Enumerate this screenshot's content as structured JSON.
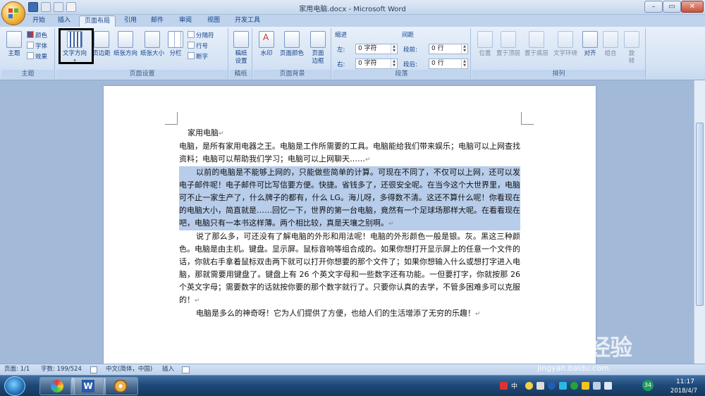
{
  "window": {
    "title": "家用电脑.docx - Microsoft Word",
    "minimize": "–",
    "maximize": "▭",
    "close": "✕"
  },
  "tabs": [
    "开始",
    "插入",
    "页面布局",
    "引用",
    "邮件",
    "审阅",
    "视图",
    "开发工具"
  ],
  "active_tab": "页面布局",
  "ribbon": {
    "theme": {
      "themes": "主题",
      "colors": "颜色",
      "fonts": "字体",
      "effects": "效果",
      "group": "主题"
    },
    "page_setup": {
      "text_direction": "文字方向",
      "margins": "页边距",
      "orientation": "纸张方向",
      "size": "纸张大小",
      "columns": "分栏",
      "breaks": "分隔符",
      "line_numbers": "行号",
      "hyphenation": "断字",
      "group": "页面设置"
    },
    "paper": {
      "draft": "稿纸设置",
      "group": "稿纸"
    },
    "background": {
      "watermark": "水印",
      "page_color": "页面颜色",
      "page_borders": "页面边框",
      "group": "页面背景"
    },
    "paragraph": {
      "indent_title": "缩进",
      "left_label": "左:",
      "left_value": "0 字符",
      "right_label": "右:",
      "right_value": "0 字符",
      "spacing_title": "间距",
      "before_label": "段前:",
      "before_value": "0 行",
      "after_label": "段后:",
      "after_value": "0 行",
      "group": "段落"
    },
    "arrange": {
      "position": "位置",
      "front": "置于顶层",
      "back": "置于底层",
      "wrap": "文字环绕",
      "align": "对齐",
      "group_btn": "组合",
      "rotate": "旋转",
      "group": "排列"
    }
  },
  "document": {
    "title": "家用电脑",
    "paragraphs": [
      {
        "text": "电脑，是所有家用电器之王。电脑是工作所需要的工具。电脑能给我们带来娱乐；电脑可以上网查找资料；电脑可以帮助我们学习；电脑可以上网聊天……",
        "selected": false,
        "indent": false
      },
      {
        "text": "以前的电脑是不能够上网的，只能做些简单的计算。可现在不同了，不仅可以上网，还可以发电子邮件呢！电子邮件可比写信要方便。快捷。省钱多了，还很安全呢。在当今这个大世界里，电脑可不止一家生产了，什么牌子的都有，什么 LG。海儿呀，多得数不清。这还不算什么呢！你看现在的电脑大小，简直就是……回忆一下，世界的第一台电脑，竟然有一个足球场那样大呢。在看看现在吧，电脑只有一本书这样薄。两个相比较，真是天壤之别啊。",
        "selected": true,
        "indent": true
      },
      {
        "text": "说了那么多，可还没有了解电脑的外形和用法呢！电脑的外形颜色一般是银。灰。黑这三种颜色。电脑是由主机。键盘。显示屏。鼠标音响等组合成的。如果你想打开显示屏上的任意一个文件的话，你就右手拿着鼠标双击两下就可以打开你想要的那个文件了；如果你想输入什么或想打字进入电脑，那就需要用键盘了。键盘上有 26 个英文字母和一些数字还有功能。一但要打字，你就按那 26 个英文字母；需要数字的话就按你要的那个数字就行了。只要你认真的去学，不管多困难多可以克服的！",
        "selected": false,
        "indent": true
      },
      {
        "text": "电脑是多么的神奇呀！它为人们提供了方便，也给人们的生活增添了无穷的乐趣！",
        "selected": false,
        "indent": true
      }
    ]
  },
  "status": {
    "page": "页面: 1/1",
    "words": "字数: 199/524",
    "language": "中文(简体，中国)",
    "mode": "插入"
  },
  "tray": {
    "ime": "中",
    "badge": "34",
    "time": "11:17",
    "date": "2018/4/7"
  },
  "watermark": {
    "brand": "Bai 经验",
    "url": "jingyan.baidu.com"
  }
}
